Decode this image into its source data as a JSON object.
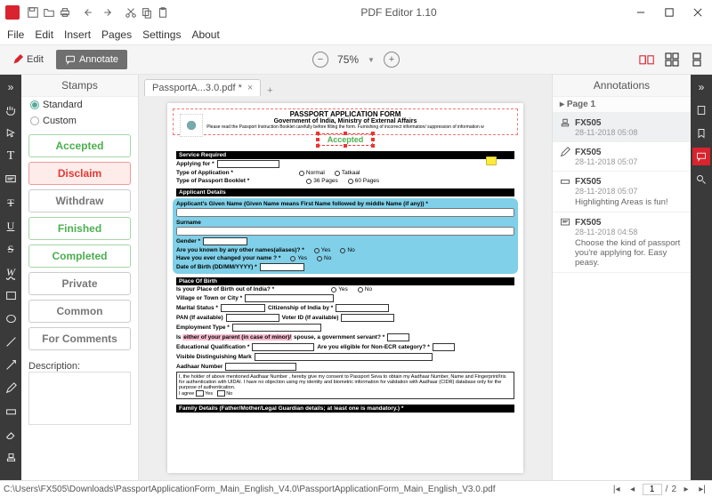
{
  "app": {
    "title": "PDF Editor 1.10"
  },
  "menu": [
    "File",
    "Edit",
    "Insert",
    "Pages",
    "Settings",
    "About"
  ],
  "toolbar": {
    "edit": "Edit",
    "annotate": "Annotate",
    "zoom": "75%"
  },
  "stamps": {
    "title": "Stamps",
    "modes": {
      "standard": "Standard",
      "custom": "Custom"
    },
    "list": [
      {
        "label": "Accepted",
        "cls": "green"
      },
      {
        "label": "Disclaim",
        "cls": "red"
      },
      {
        "label": "Withdraw",
        "cls": "grey"
      },
      {
        "label": "Finished",
        "cls": "green"
      },
      {
        "label": "Completed",
        "cls": "green"
      },
      {
        "label": "Private",
        "cls": "grey"
      },
      {
        "label": "Common",
        "cls": "grey"
      },
      {
        "label": "For Comments",
        "cls": "grey"
      }
    ],
    "desc_label": "Description:"
  },
  "tab": {
    "label": "PassportA...3.0.pdf *"
  },
  "doc": {
    "title1": "PASSPORT APPLICATION FORM",
    "title2": "Government of India, Ministry of External Affairs",
    "instr": "Please read the Passport Instruction Booklet carefully before filling the form. Furnishing of incorrect information/ suppression of information w",
    "stamp": "Accepted",
    "sect_service": "Service Required",
    "applying_for": "Applying for *",
    "type_app": "Type of Application *",
    "type_app_o1": "Normal",
    "type_app_o2": "Tatkaal",
    "type_book": "Type of Passport Booklet *",
    "type_book_o1": "36 Pages",
    "type_book_o2": "60 Pages",
    "sect_applicant": "Applicant Details",
    "given_name": "Applicant's Given Name (Given Name means First Name followed by middle Name (if any)) *",
    "surname": "Surname",
    "gender": "Gender *",
    "known_by": "Are you known by any other names(aliases)? *",
    "changed": "Have you ever changed your name ? *",
    "dob": "Date of Birth (DD/MM/YYYY) *",
    "yes": "Yes",
    "no": "No",
    "sect_pob": "Place Of Birth",
    "pob_out": "Is your Place of Birth out of India? *",
    "village": "Village or Town or City *",
    "marital": "Marital Status *",
    "citizenship": "Citizenship of India by *",
    "pan": "PAN (If available)",
    "voter": "Voter ID (If available)",
    "emp_type": "Employment Type *",
    "parent_q": "Is either of your parent (in case of minor)/ spouse, a government servant? *",
    "parent_hl": "either of your parent (in case of minor)/",
    "edu": "Educational Qualification *",
    "non_ecr": "Are you eligible for Non-ECR category? *",
    "vis_mark": "Visible Distinguishing Mark",
    "aadhaar": "Aadhaar Number",
    "aadhaar_decl": "I, the holder of above mentioned Aadhaar Number , hereby give my consent to Passport Seva to obtain my Aadhaar Number, Name and Fingerprint/Iris for authentication with UIDAI. I have no objection using my identity and biometric information for validation with Aadhaar (CIDR) database only for the purpose of authentication.",
    "agree": "I agree",
    "sect_family": "Family Details (Father/Mother/Legal Guardian details; at least one is mandatory.) *"
  },
  "annotations": {
    "title": "Annotations",
    "page_label": "Page 1",
    "items": [
      {
        "icon": "stamp",
        "name": "FX505",
        "ts": "28-11-2018 05:08",
        "txt": ""
      },
      {
        "icon": "pen",
        "name": "FX505",
        "ts": "28-11-2018 05:07",
        "txt": ""
      },
      {
        "icon": "hl",
        "name": "FX505",
        "ts": "28-11-2018 05:07",
        "txt": "Highlighting Areas is fun!"
      },
      {
        "icon": "note",
        "name": "FX505",
        "ts": "28-11-2018 04:58",
        "txt": "Choose the kind of passport you're applying for. Easy peasy."
      }
    ]
  },
  "status": {
    "path": "C:\\Users\\FX505\\Downloads\\PassportApplicationForm_Main_English_V4.0\\PassportApplicationForm_Main_English_V3.0.pdf",
    "page": "1",
    "total": "2"
  }
}
